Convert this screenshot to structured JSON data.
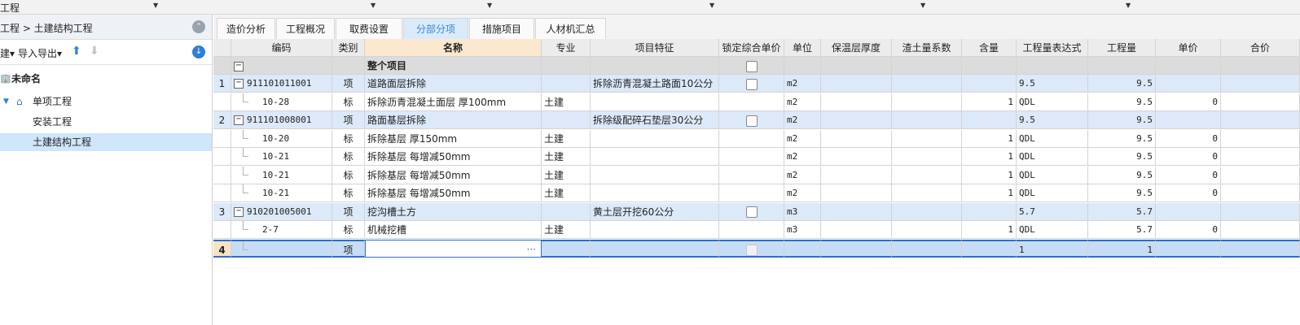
{
  "topbar": {
    "project_label": "工程"
  },
  "left": {
    "breadcrumb": "工程 > 土建结构工程",
    "toolbar": {
      "partial_label": "建",
      "import_export_label": "导入导出"
    },
    "tree": {
      "root": "未命名",
      "single": "单项工程",
      "children": [
        "安装工程",
        "土建结构工程"
      ]
    }
  },
  "tabs": [
    "造价分析",
    "工程概况",
    "取费设置",
    "分部分项",
    "措施项目",
    "人材机汇总"
  ],
  "active_tab": "分部分项",
  "table": {
    "headers": [
      "",
      "编码",
      "类别",
      "名称",
      "专业",
      "项目特征",
      "锁定综合单价",
      "单位",
      "保温层厚度",
      "渣土量系数",
      "含量",
      "工程量表达式",
      "工程量",
      "单价",
      "合价"
    ],
    "whole_label": "整个项目",
    "rows": [
      {
        "no": "1",
        "code": "911101011001",
        "cat": "项",
        "name": "道路面层拆除",
        "spec": "",
        "feature": "拆除沥青混凝土路面10公分",
        "unit": "m2",
        "content": "",
        "expr": "9.5",
        "qty": "9.5",
        "price": ""
      },
      {
        "no": "",
        "code": "10-28",
        "cat": "标",
        "name": "拆除沥青混凝土面层 厚100mm",
        "spec": "土建",
        "feature": "",
        "unit": "m2",
        "content": "1",
        "expr": "QDL",
        "qty": "9.5",
        "price": "0"
      },
      {
        "no": "2",
        "code": "911101008001",
        "cat": "项",
        "name": "路面基层拆除",
        "spec": "",
        "feature": "拆除级配碎石垫层30公分",
        "unit": "m2",
        "content": "",
        "expr": "9.5",
        "qty": "9.5",
        "price": ""
      },
      {
        "no": "",
        "code": "10-20",
        "cat": "标",
        "name": "拆除基层 厚150mm",
        "spec": "土建",
        "feature": "",
        "unit": "m2",
        "content": "1",
        "expr": "QDL",
        "qty": "9.5",
        "price": "0"
      },
      {
        "no": "",
        "code": "10-21",
        "cat": "标",
        "name": "拆除基层 每增减50mm",
        "spec": "土建",
        "feature": "",
        "unit": "m2",
        "content": "1",
        "expr": "QDL",
        "qty": "9.5",
        "price": "0"
      },
      {
        "no": "",
        "code": "10-21",
        "cat": "标",
        "name": "拆除基层 每增减50mm",
        "spec": "土建",
        "feature": "",
        "unit": "m2",
        "content": "1",
        "expr": "QDL",
        "qty": "9.5",
        "price": "0"
      },
      {
        "no": "",
        "code": "10-21",
        "cat": "标",
        "name": "拆除基层 每增减50mm",
        "spec": "土建",
        "feature": "",
        "unit": "m2",
        "content": "1",
        "expr": "QDL",
        "qty": "9.5",
        "price": "0"
      },
      {
        "no": "3",
        "code": "910201005001",
        "cat": "项",
        "name": "挖沟槽土方",
        "spec": "",
        "feature": "黄土层开挖60公分",
        "unit": "m3",
        "content": "",
        "expr": "5.7",
        "qty": "5.7",
        "price": ""
      },
      {
        "no": "",
        "code": "2-7",
        "cat": "标",
        "name": "机械挖槽",
        "spec": "土建",
        "feature": "",
        "unit": "m3",
        "content": "1",
        "expr": "QDL",
        "qty": "5.7",
        "price": "0"
      },
      {
        "no": "4",
        "code": "",
        "cat": "项",
        "name": "",
        "spec": "",
        "feature": "",
        "unit": "",
        "content": "",
        "expr": "1",
        "qty": "1",
        "price": ""
      }
    ],
    "ellipsis": "···"
  },
  "colors": {
    "active_tab": "#3a87d8",
    "selection": "#2b6fd0",
    "item_row": "#dce9f9"
  }
}
